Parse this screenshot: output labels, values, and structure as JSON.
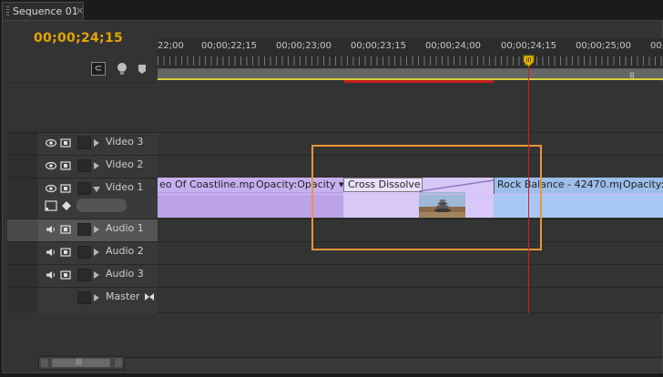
{
  "tab": {
    "title": "Sequence 01",
    "close": "×"
  },
  "timecode": "00;00;24;15",
  "toolbar": {
    "snap_glyph": "⊂"
  },
  "ruler": {
    "labels": [
      "22;00",
      "00;00;22;15",
      "00;00;23;00",
      "00;00;23;15",
      "00;00;24;00",
      "00;00;24;15",
      "00;00;25;00",
      "00;"
    ]
  },
  "tracks": [
    {
      "name": "Video 3",
      "kind": "video",
      "expanded": false
    },
    {
      "name": "Video 2",
      "kind": "video",
      "expanded": false
    },
    {
      "name": "Video 1",
      "kind": "video",
      "expanded": true
    },
    {
      "name": "Audio 1",
      "kind": "audio",
      "expanded": false,
      "selected": true
    },
    {
      "name": "Audio 2",
      "kind": "audio",
      "expanded": false
    },
    {
      "name": "Audio 3",
      "kind": "audio",
      "expanded": false
    },
    {
      "name": "Master",
      "kind": "master",
      "expanded": false
    }
  ],
  "clips": {
    "coastline": {
      "name": "eo Of Coastline.mp4",
      "opacity": "Opacity:Opacity ▾"
    },
    "dissolve": {
      "name": "Cross Dissolve"
    },
    "rock": {
      "name": "Rock Balance - 42470.mp4",
      "opacity": "Opacity:"
    }
  },
  "icons": {
    "eye": "eye-icon",
    "film": "filmstrip-icon",
    "speaker": "speaker-icon",
    "marker": "marker-icon",
    "snap": "snap-icon",
    "playhead": "playhead-icon"
  },
  "colors": {
    "timecode": "#e4a500",
    "video_clip": "#c8b0f0",
    "rock_clip": "#a7c8f3",
    "playhead": "#d22020",
    "selection": "#e8963a"
  }
}
